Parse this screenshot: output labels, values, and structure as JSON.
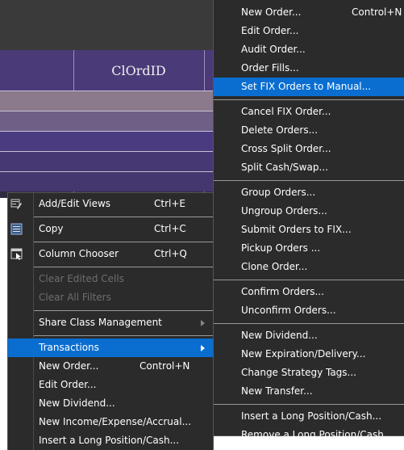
{
  "grid": {
    "column_header": "ClOrdID"
  },
  "context_menu": {
    "items": [
      {
        "label": "Add/Edit Views",
        "shortcut": "Ctrl+E",
        "icon": "edit-views-icon"
      },
      {
        "label": "Copy",
        "shortcut": "Ctrl+C",
        "icon": "copy-icon"
      },
      {
        "label": "Column Chooser",
        "shortcut": "Ctrl+Q",
        "icon": "column-chooser-icon"
      },
      {
        "label": "Clear Edited Cells"
      },
      {
        "label": "Clear All Filters"
      },
      {
        "label": "Share Class Management"
      },
      {
        "label": "Transactions"
      },
      {
        "label": "New Order...",
        "shortcut": "Control+N"
      },
      {
        "label": "Edit Order..."
      },
      {
        "label": "New Dividend..."
      },
      {
        "label": "New Income/Expense/Accrual..."
      },
      {
        "label": "Insert a Long Position/Cash..."
      }
    ]
  },
  "submenu": {
    "items": [
      {
        "label": "New Order...",
        "shortcut": "Control+N"
      },
      {
        "label": "Edit Order..."
      },
      {
        "label": "Audit Order..."
      },
      {
        "label": "Order Fills..."
      },
      {
        "label": "Set FIX Orders to Manual..."
      },
      {
        "label": "Cancel FIX Order..."
      },
      {
        "label": "Delete Orders..."
      },
      {
        "label": "Cross Split Order..."
      },
      {
        "label": "Split Cash/Swap..."
      },
      {
        "label": "Group Orders..."
      },
      {
        "label": "Ungroup Orders..."
      },
      {
        "label": "Submit Orders to FIX..."
      },
      {
        "label": "Pickup Orders ..."
      },
      {
        "label": "Clone Order..."
      },
      {
        "label": "Confirm Orders..."
      },
      {
        "label": "Unconfirm Orders..."
      },
      {
        "label": "New Dividend..."
      },
      {
        "label": "New Expiration/Delivery..."
      },
      {
        "label": "Change Strategy Tags..."
      },
      {
        "label": "New Transfer..."
      },
      {
        "label": "Insert a Long Position/Cash..."
      },
      {
        "label": "Remove a Long Position/Cash..."
      }
    ]
  },
  "colors": {
    "highlight": "#0a6ed1",
    "menu_bg": "#2b2b2b",
    "grid_header": "#4a3a78"
  }
}
